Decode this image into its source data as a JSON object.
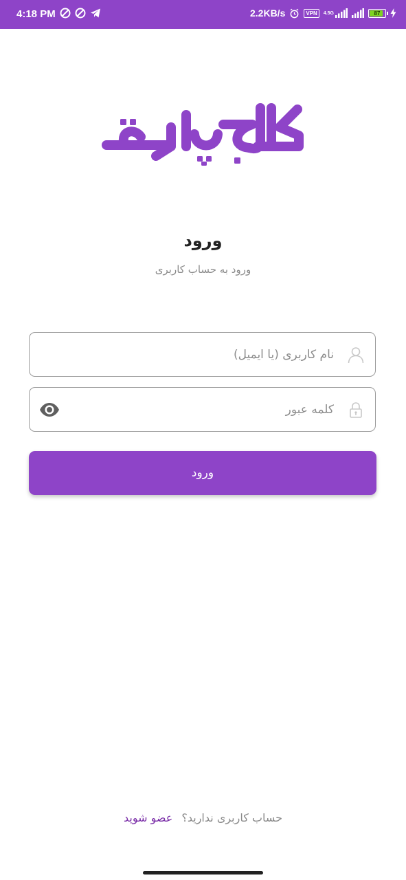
{
  "status_bar": {
    "time": "4:18 PM",
    "net_speed": "2.2KB/s",
    "vpn_label": "VPN",
    "network_type": "4.5G",
    "battery_level": "87",
    "background_color": "#8e44c8"
  },
  "logo": {
    "text": "کالج پارت",
    "color": "#8e44c8"
  },
  "header": {
    "title": "ورود",
    "subtitle": "ورود به حساب کاربری"
  },
  "form": {
    "username": {
      "placeholder": "نام کاربری (یا ایمیل)",
      "value": "",
      "icon": "user-icon"
    },
    "password": {
      "placeholder": "کلمه عبور",
      "value": "",
      "icon": "lock-icon",
      "toggle_icon": "eye-icon"
    },
    "submit_label": "ورود"
  },
  "signup": {
    "question": "حساب کاربری ندارید؟",
    "link_label": "عضو شوید"
  },
  "colors": {
    "accent": "#8e44c8",
    "link": "#7b2fa8",
    "muted_text": "#8a8a8a"
  }
}
